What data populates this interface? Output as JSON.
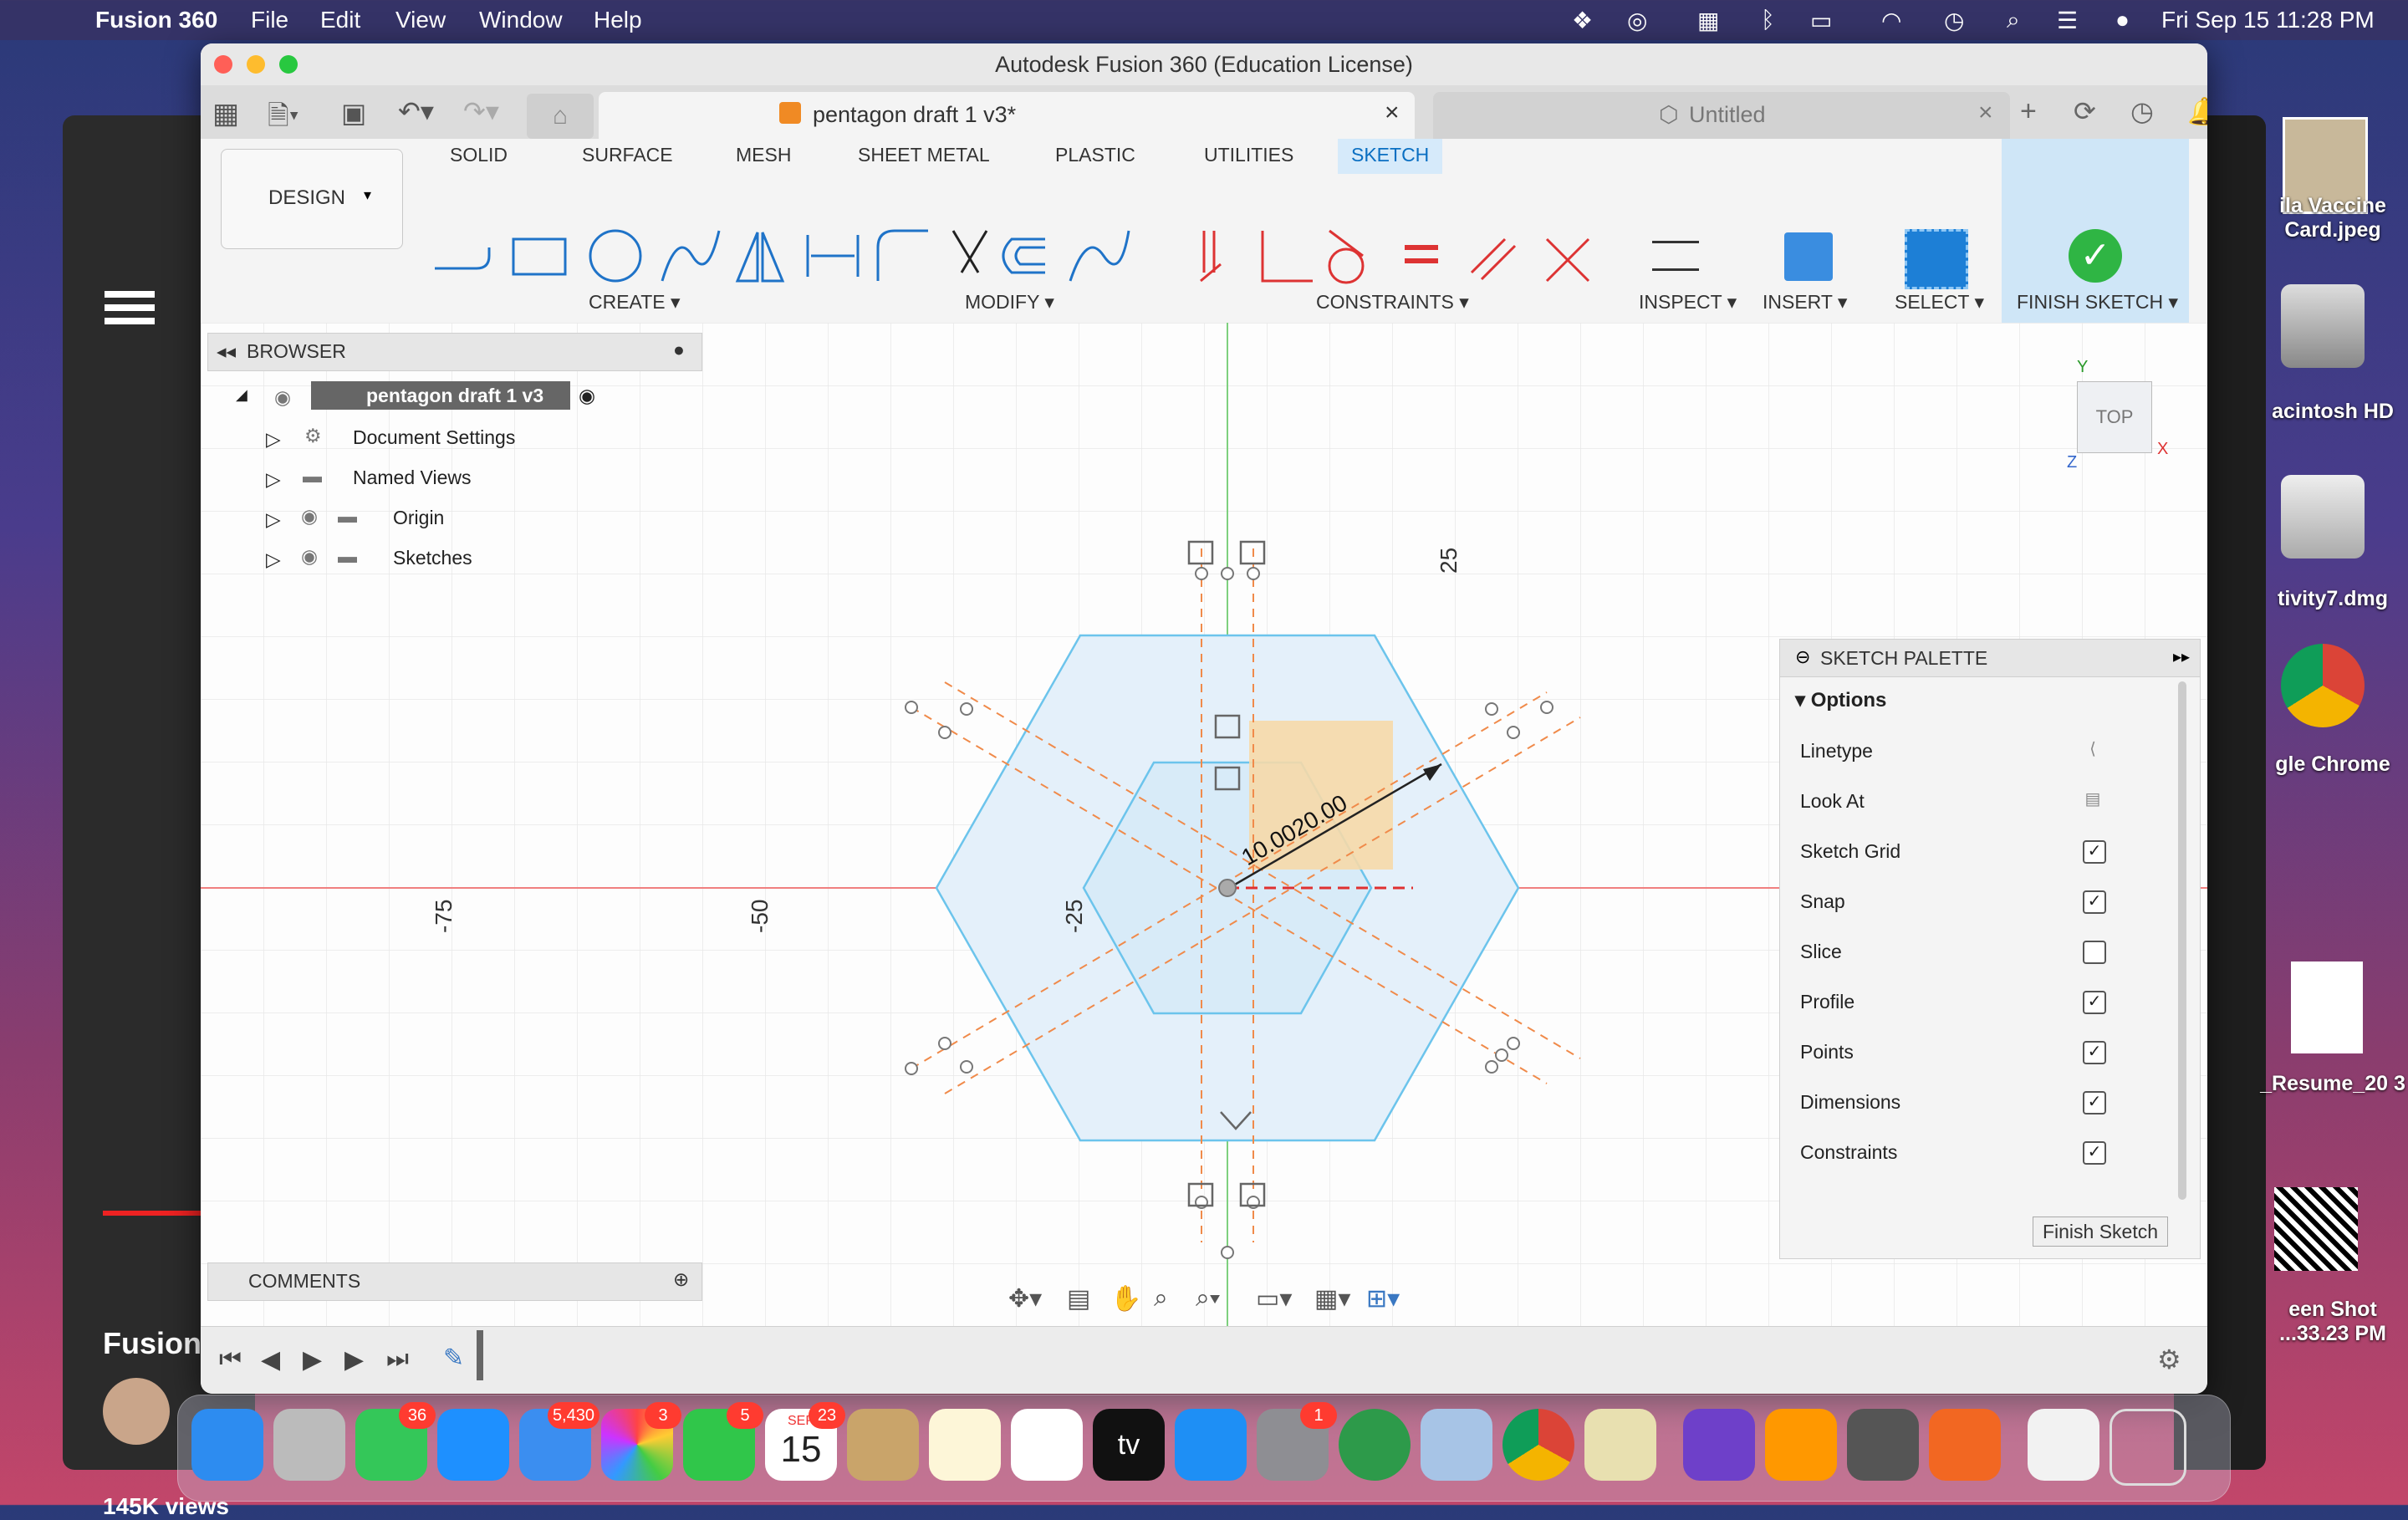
{
  "menubar": {
    "app": "Fusion 360",
    "items": [
      "File",
      "Edit",
      "View",
      "Window",
      "Help"
    ],
    "datetime": "Fri Sep 15  11:28 PM"
  },
  "window": {
    "title": "Autodesk Fusion 360 (Education License)",
    "active_tab": "pentagon draft 1 v3*",
    "inactive_tab": "Untitled"
  },
  "toolbar": {
    "workspace": "DESIGN",
    "tabs": [
      "SOLID",
      "SURFACE",
      "MESH",
      "SHEET METAL",
      "PLASTIC",
      "UTILITIES",
      "SKETCH"
    ],
    "active_tab": "SKETCH",
    "groups": {
      "create": "CREATE",
      "modify": "MODIFY",
      "constraints": "CONSTRAINTS",
      "inspect": "INSPECT",
      "insert": "INSERT",
      "select": "SELECT",
      "finish": "FINISH SKETCH"
    }
  },
  "browser": {
    "title": "BROWSER",
    "root": "pentagon draft 1 v3",
    "items": [
      "Document Settings",
      "Named Views",
      "Origin",
      "Sketches"
    ]
  },
  "comments": {
    "title": "COMMENTS"
  },
  "viewcube": {
    "face": "TOP",
    "y": "Y",
    "x": "X",
    "z": "Z"
  },
  "canvas": {
    "axis_labels": [
      "-75",
      "-50",
      "-25",
      "25"
    ],
    "dimension_text": "10.0020.00"
  },
  "palette": {
    "title": "SKETCH PALETTE",
    "section": "Options",
    "rows": [
      {
        "label": "Linetype",
        "type": "icon"
      },
      {
        "label": "Look At",
        "type": "icon"
      },
      {
        "label": "Sketch Grid",
        "type": "check",
        "checked": true
      },
      {
        "label": "Snap",
        "type": "check",
        "checked": true
      },
      {
        "label": "Slice",
        "type": "check",
        "checked": false
      },
      {
        "label": "Profile",
        "type": "check",
        "checked": true
      },
      {
        "label": "Points",
        "type": "check",
        "checked": true
      },
      {
        "label": "Dimensions",
        "type": "check",
        "checked": true
      },
      {
        "label": "Constraints",
        "type": "check",
        "checked": true
      }
    ],
    "finish_button": "Finish Sketch"
  },
  "desktop": {
    "icons": [
      "ila Vaccine Card.jpeg",
      "acintosh HD",
      "tivity7.dmg",
      "gle Chrome",
      "_Resume_20 3",
      "een Shot ...33.23 PM"
    ],
    "left_video_title": "Fusion",
    "left_views": "145K views"
  },
  "dock": {
    "badges": {
      "messages": "36",
      "mail": "5,430",
      "photos": "3",
      "facetime": "5",
      "calendar": "23",
      "settings": "1"
    },
    "calendar_month": "SEP",
    "calendar_day": "15",
    "tv_label": "tv"
  }
}
